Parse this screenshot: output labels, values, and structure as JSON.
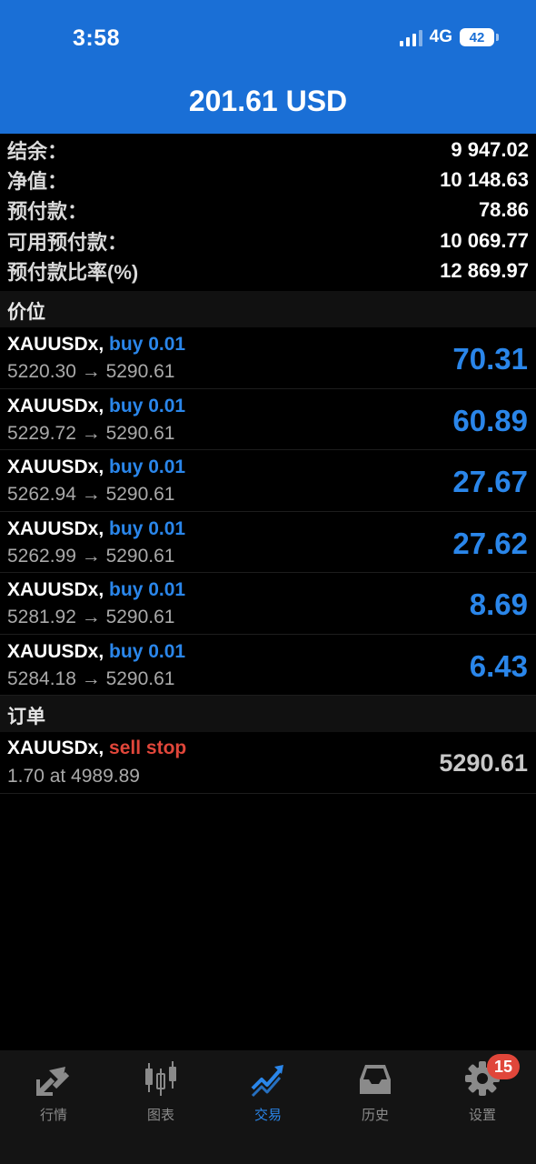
{
  "status_bar": {
    "time": "3:58",
    "network": "4G",
    "battery": "42"
  },
  "header": {
    "title": "201.61 USD"
  },
  "summary": [
    {
      "label": "结余：",
      "value": "9 947.02"
    },
    {
      "label": "净值：",
      "value": "10 148.63"
    },
    {
      "label": "预付款：",
      "value": "78.86"
    },
    {
      "label": "可用预付款：",
      "value": "10 069.77"
    },
    {
      "label": "预付款比率(%)",
      "value": "12 869.97"
    }
  ],
  "positions_section": {
    "title": "价位"
  },
  "positions": [
    {
      "symbol": "XAUUSDx,",
      "action": "buy 0.01",
      "prices": "5220.30 → 5290.61",
      "profit": "70.31"
    },
    {
      "symbol": "XAUUSDx,",
      "action": "buy 0.01",
      "prices": "5229.72 → 5290.61",
      "profit": "60.89"
    },
    {
      "symbol": "XAUUSDx,",
      "action": "buy 0.01",
      "prices": "5262.94 → 5290.61",
      "profit": "27.67"
    },
    {
      "symbol": "XAUUSDx,",
      "action": "buy 0.01",
      "prices": "5262.99 → 5290.61",
      "profit": "27.62"
    },
    {
      "symbol": "XAUUSDx,",
      "action": "buy 0.01",
      "prices": "5281.92 → 5290.61",
      "profit": "8.69"
    },
    {
      "symbol": "XAUUSDx,",
      "action": "buy 0.01",
      "prices": "5284.18 → 5290.61",
      "profit": "6.43"
    }
  ],
  "orders_section": {
    "title": "订单"
  },
  "orders": [
    {
      "symbol": "XAUUSDx,",
      "action": "sell stop",
      "detail": "1.70 at 4989.89",
      "price": "5290.61"
    }
  ],
  "tabbar": {
    "tabs": [
      {
        "label": "行情",
        "icon": "arrows-icon"
      },
      {
        "label": "图表",
        "icon": "candlestick-icon"
      },
      {
        "label": "交易",
        "icon": "trend-icon"
      },
      {
        "label": "历史",
        "icon": "inbox-icon"
      },
      {
        "label": "设置",
        "icon": "gear-icon"
      }
    ],
    "active": "交易",
    "settings_badge": "15"
  },
  "colors": {
    "header": "#1a6fd6",
    "accent": "#2a86ea",
    "sell": "#e0463a",
    "background": "#000000"
  }
}
